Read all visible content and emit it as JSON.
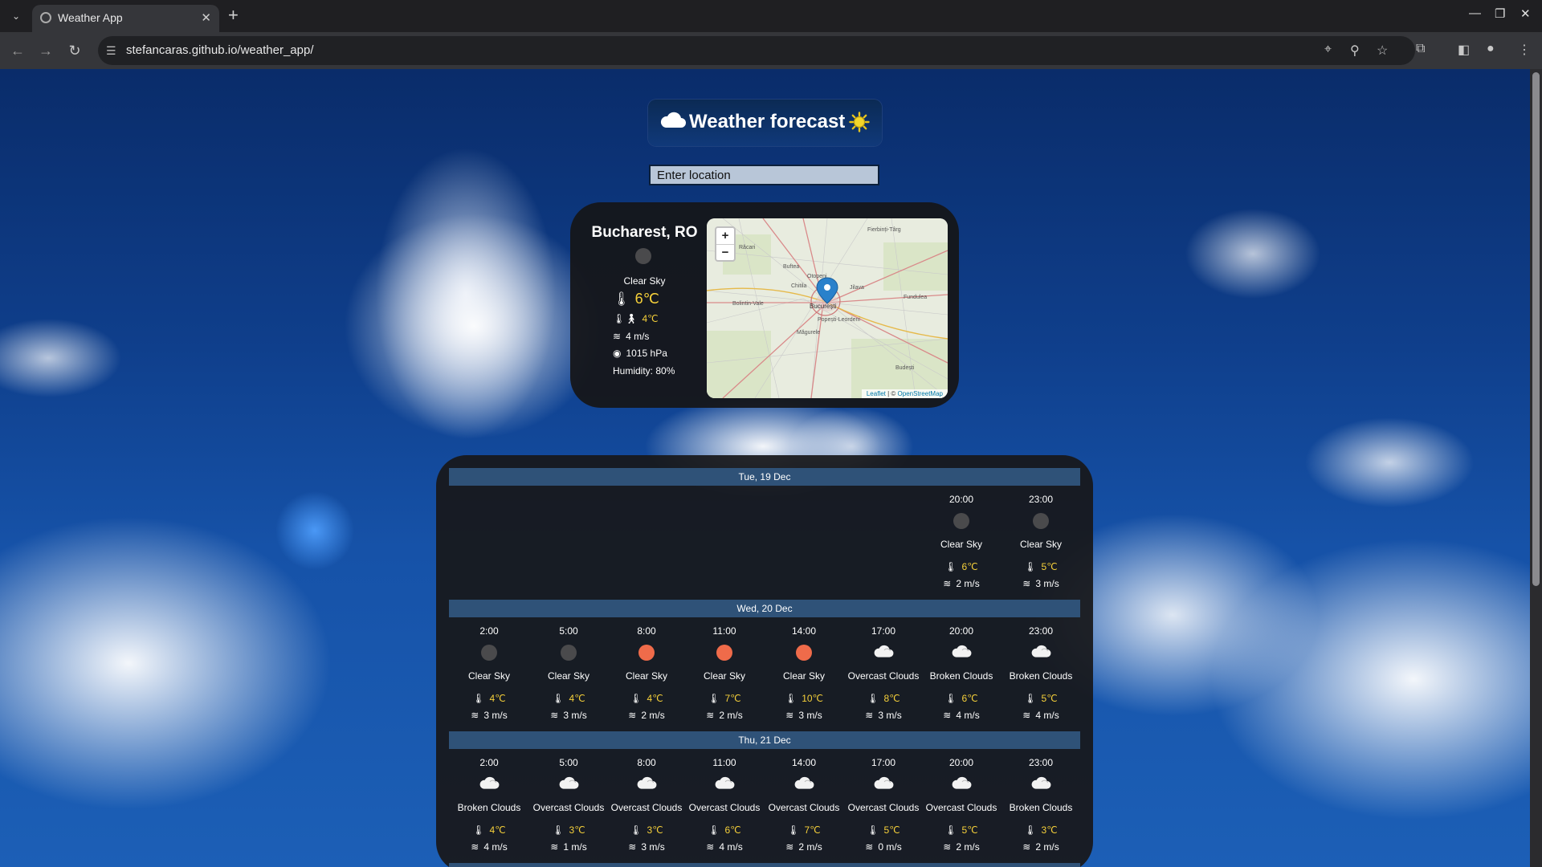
{
  "browser": {
    "tab_title": "Weather App",
    "url": "stefancaras.github.io/weather_app/"
  },
  "app": {
    "title": "Weather forecast",
    "search_placeholder": "Enter location"
  },
  "current": {
    "city": "Bucharest, RO",
    "description": "Clear Sky",
    "temperature": "6℃",
    "feels_like": "4℃",
    "wind": "4 m/s",
    "pressure": "1015 hPa",
    "humidity": "Humidity: 80%"
  },
  "map": {
    "zoom_in": "+",
    "zoom_out": "−",
    "attribution_leaflet": "Leaflet",
    "attribution_sep": " | © ",
    "attribution_osm": "OpenStreetMap",
    "labels": [
      "Fierbinți-Târg",
      "Răcari",
      "Buftea",
      "Otopeni",
      "Chitila",
      "Jilava",
      "Fundulea",
      "Bolintin-Vale",
      "București",
      "Popești-Leordeni",
      "Măgurele",
      "Budești"
    ]
  },
  "forecast": {
    "days": [
      {
        "label": "Tue, 19 Dec",
        "slots": [
          {
            "time": "20:00",
            "icon": "night-dot",
            "desc": "Clear Sky",
            "temp": "6℃",
            "wind": "2 m/s"
          },
          {
            "time": "23:00",
            "icon": "night-dot",
            "desc": "Clear Sky",
            "temp": "5℃",
            "wind": "3 m/s"
          }
        ]
      },
      {
        "label": "Wed, 20 Dec",
        "slots": [
          {
            "time": "2:00",
            "icon": "night-dot",
            "desc": "Clear Sky",
            "temp": "4℃",
            "wind": "3 m/s"
          },
          {
            "time": "5:00",
            "icon": "night-dot",
            "desc": "Clear Sky",
            "temp": "4℃",
            "wind": "3 m/s"
          },
          {
            "time": "8:00",
            "icon": "sun-dot",
            "desc": "Clear Sky",
            "temp": "4℃",
            "wind": "2 m/s"
          },
          {
            "time": "11:00",
            "icon": "sun-dot",
            "desc": "Clear Sky",
            "temp": "7℃",
            "wind": "2 m/s"
          },
          {
            "time": "14:00",
            "icon": "sun-dot",
            "desc": "Clear Sky",
            "temp": "10℃",
            "wind": "3 m/s"
          },
          {
            "time": "17:00",
            "icon": "cloud",
            "desc": "Overcast Clouds",
            "temp": "8℃",
            "wind": "3 m/s"
          },
          {
            "time": "20:00",
            "icon": "cloud",
            "desc": "Broken Clouds",
            "temp": "6℃",
            "wind": "4 m/s"
          },
          {
            "time": "23:00",
            "icon": "cloud",
            "desc": "Broken Clouds",
            "temp": "5℃",
            "wind": "4 m/s"
          }
        ]
      },
      {
        "label": "Thu, 21 Dec",
        "slots": [
          {
            "time": "2:00",
            "icon": "cloud",
            "desc": "Broken Clouds",
            "temp": "4℃",
            "wind": "4 m/s"
          },
          {
            "time": "5:00",
            "icon": "cloud",
            "desc": "Overcast Clouds",
            "temp": "3℃",
            "wind": "1 m/s"
          },
          {
            "time": "8:00",
            "icon": "cloud",
            "desc": "Overcast Clouds",
            "temp": "3℃",
            "wind": "3 m/s"
          },
          {
            "time": "11:00",
            "icon": "cloud",
            "desc": "Overcast Clouds",
            "temp": "6℃",
            "wind": "4 m/s"
          },
          {
            "time": "14:00",
            "icon": "cloud",
            "desc": "Overcast Clouds",
            "temp": "7℃",
            "wind": "2 m/s"
          },
          {
            "time": "17:00",
            "icon": "cloud",
            "desc": "Overcast Clouds",
            "temp": "5℃",
            "wind": "0 m/s"
          },
          {
            "time": "20:00",
            "icon": "cloud",
            "desc": "Overcast Clouds",
            "temp": "5℃",
            "wind": "2 m/s"
          },
          {
            "time": "23:00",
            "icon": "cloud",
            "desc": "Broken Clouds",
            "temp": "3℃",
            "wind": "2 m/s"
          }
        ]
      }
    ]
  },
  "colors": {
    "accent_temp": "#f7d13a",
    "day_header": "#2f5278",
    "sun_icon": "#ef6b4a",
    "night_icon": "#4a4a4c"
  }
}
